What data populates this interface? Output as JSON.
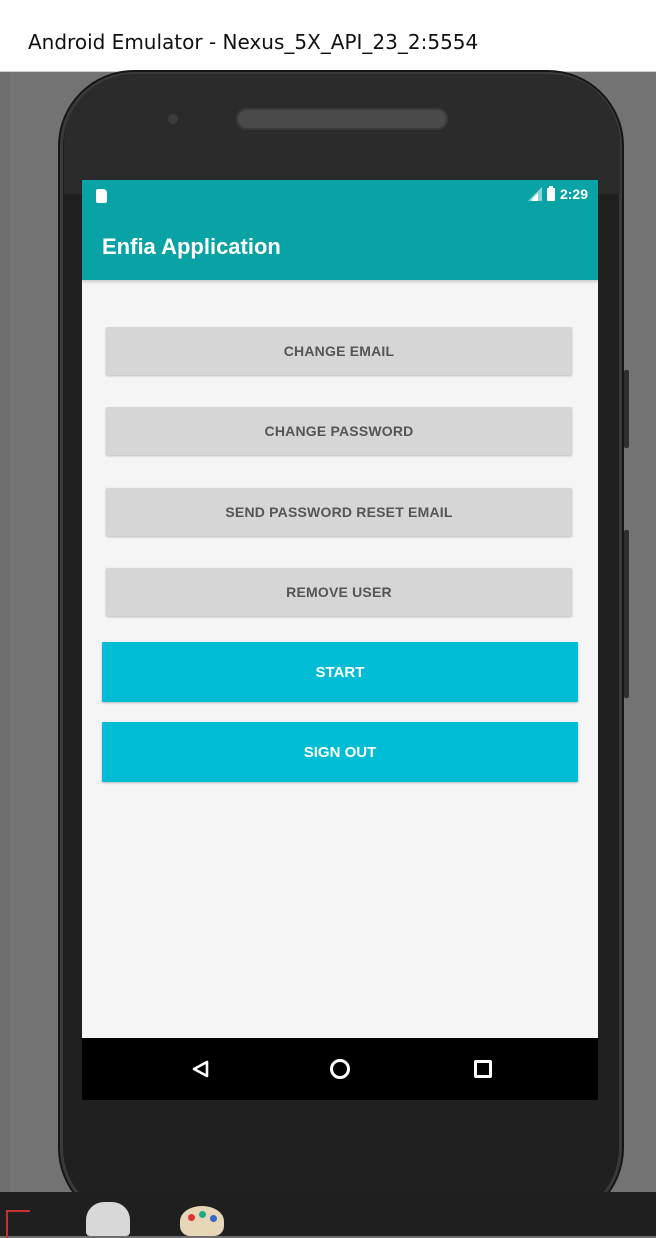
{
  "window": {
    "title": "Android Emulator - Nexus_5X_API_23_2:5554"
  },
  "status_bar": {
    "time": "2:29",
    "icons": [
      "sd-card-icon",
      "signal-icon",
      "battery-icon"
    ]
  },
  "app": {
    "title": "Enfia Application",
    "primary_color": "#0aa3a5",
    "accent_color": "#00bcd4"
  },
  "buttons": {
    "change_email": "CHANGE EMAIL",
    "change_password": "CHANGE PASSWORD",
    "send_reset": "SEND PASSWORD RESET EMAIL",
    "remove_user": "REMOVE USER",
    "start": "START",
    "sign_out": "SIGN OUT"
  },
  "nav_bar": {
    "icons": [
      "back-icon",
      "home-icon",
      "recents-icon"
    ]
  },
  "taskbar": {
    "icons": [
      "app-icon",
      "app-icon",
      "paint-icon"
    ]
  }
}
